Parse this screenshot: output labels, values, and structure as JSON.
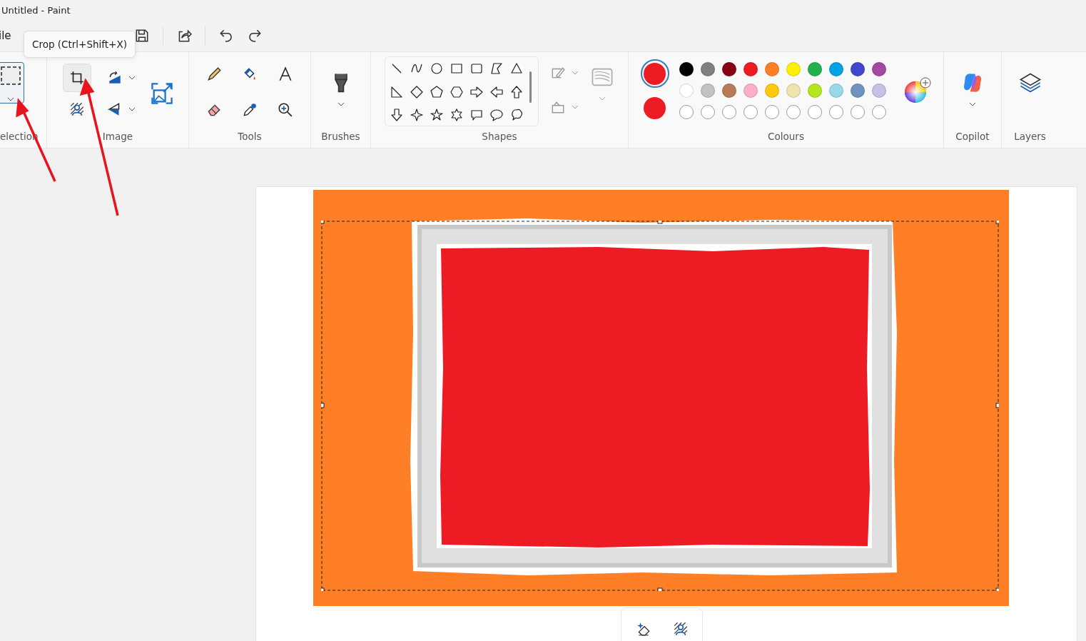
{
  "window": {
    "title": "Untitled - Paint"
  },
  "menu": [
    {
      "label": "ile"
    }
  ],
  "tooltip": {
    "text": "Crop (Ctrl+Shift+X)"
  },
  "ribbon": {
    "selection_tool": {
      "selected": true
    },
    "crop_tool": {
      "selected": true
    },
    "group_labels": [
      "election",
      "Image",
      "Tools",
      "Brushes",
      "Shapes",
      "Colours",
      "Copilot",
      "Layers"
    ]
  },
  "colours": {
    "current": [
      {
        "color": "#ed1c24",
        "selected": true
      },
      {
        "color": "#ed1c24",
        "selected": false
      }
    ],
    "swatches": [
      {
        "kind": "colour",
        "color": "#000000"
      },
      {
        "kind": "colour",
        "color": "#7f7f7f"
      },
      {
        "kind": "colour",
        "color": "#880015"
      },
      {
        "kind": "colour",
        "color": "#ed1c24"
      },
      {
        "kind": "colour",
        "color": "#ff7f27"
      },
      {
        "kind": "colour",
        "color": "#fff200"
      },
      {
        "kind": "colour",
        "color": "#22b14c"
      },
      {
        "kind": "colour",
        "color": "#00a2e8"
      },
      {
        "kind": "colour",
        "color": "#3f48cc"
      },
      {
        "kind": "colour",
        "color": "#a349a4"
      },
      {
        "kind": "colour",
        "color": "#ffffff"
      },
      {
        "kind": "colour",
        "color": "#c3c3c3"
      },
      {
        "kind": "colour",
        "color": "#b97a57"
      },
      {
        "kind": "colour",
        "color": "#ffaec9"
      },
      {
        "kind": "colour",
        "color": "#ffc90e"
      },
      {
        "kind": "colour",
        "color": "#efe4b0"
      },
      {
        "kind": "colour",
        "color": "#b5e61d"
      },
      {
        "kind": "colour",
        "color": "#99d9ea"
      },
      {
        "kind": "colour",
        "color": "#7092be"
      },
      {
        "kind": "colour",
        "color": "#c8bfe7"
      },
      {
        "kind": "empty"
      },
      {
        "kind": "empty"
      },
      {
        "kind": "empty"
      },
      {
        "kind": "empty"
      },
      {
        "kind": "empty"
      },
      {
        "kind": "empty"
      },
      {
        "kind": "empty"
      },
      {
        "kind": "empty"
      },
      {
        "kind": "empty"
      },
      {
        "kind": "empty"
      }
    ]
  }
}
